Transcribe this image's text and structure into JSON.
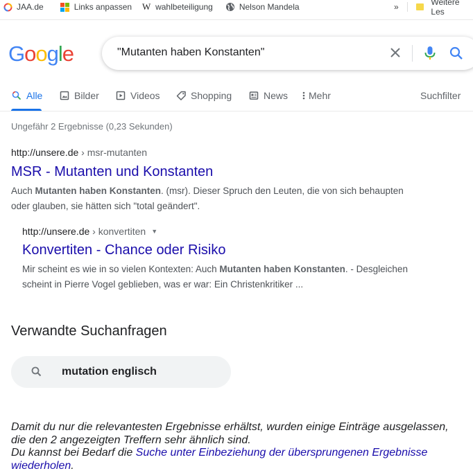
{
  "bookmarks": [
    {
      "label": "JAA.de",
      "icon": "jaa-icon"
    },
    {
      "label": "Links anpassen",
      "icon": "windows-icon"
    },
    {
      "label": "wahlbeteiligung",
      "icon": "wikipedia-icon"
    },
    {
      "label": "Nelson Mandela",
      "icon": "globe-icon"
    }
  ],
  "bookmarks_overflow": "»",
  "bookmarks_other": "Weitere Les",
  "logo": [
    "G",
    "o",
    "o",
    "g",
    "l",
    "e"
  ],
  "logo_colors": [
    "#4285f4",
    "#ea4335",
    "#fbbc05",
    "#4285f4",
    "#34a853",
    "#ea4335"
  ],
  "search": {
    "query": "\"Mutanten haben Konstanten\""
  },
  "tabs": [
    {
      "label": "Alle",
      "icon": "search-icon",
      "active": true
    },
    {
      "label": "Bilder",
      "icon": "image-icon"
    },
    {
      "label": "Videos",
      "icon": "video-icon"
    },
    {
      "label": "Shopping",
      "icon": "tag-icon"
    },
    {
      "label": "News",
      "icon": "news-icon"
    },
    {
      "label": "Mehr",
      "icon": "more-vertical-icon"
    }
  ],
  "suchfilter": "Suchfilter",
  "stats": "Ungefähr 2 Ergebnisse (0,23 Sekunden)",
  "results": [
    {
      "site": "http://unsere.de",
      "path": " › msr-mutanten",
      "title": "MSR - Mutanten und Konstanten",
      "snippet_line1_a": "Auch ",
      "snippet_line1_b": "Mutanten haben Konstanten",
      "snippet_line1_c": ". (msr). Dieser Spruch den Leuten, die von sich behaupten",
      "snippet_line2": "oder glauben, sie hätten sich \"total geändert\"."
    },
    {
      "site": "http://unsere.de",
      "path": " › konvertiten",
      "caret": "▼",
      "title": "Konvertiten - Chance oder Risiko",
      "snippet_line1_a": "Mir scheint es wie in so vielen Kontexten: Auch ",
      "snippet_line1_b": "Mutanten haben Konstanten",
      "snippet_line1_c": ". - Desgleichen",
      "snippet_line2": "scheint in Pierre Vogel geblieben, was er war: Ein Christenkritiker ..."
    }
  ],
  "related": {
    "heading": "Verwandte Suchanfragen",
    "items": [
      "mutation englisch"
    ]
  },
  "footer": {
    "line1": "Damit du nur die relevantesten Ergebnisse erhältst, wurden einige Einträge ausgelassen,",
    "line2": "die den 2 angezeigten Treffern sehr ähnlich sind.",
    "line3_prefix": "Du kannst bei Bedarf die ",
    "line3_link": "Suche unter Einbeziehung der übersprungenen Ergebnisse",
    "line4_link": "wiederholen",
    "line4_suffix": "."
  }
}
